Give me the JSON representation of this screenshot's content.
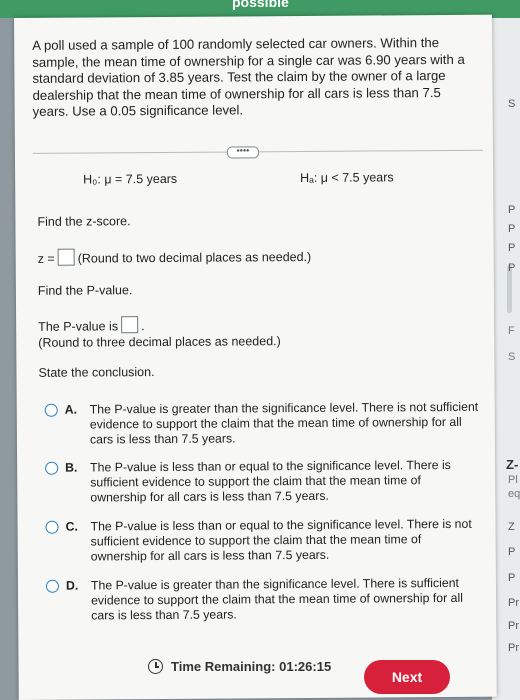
{
  "top_banner": {
    "label": "possible"
  },
  "problem": {
    "text": "A poll used a sample of 100 randomly selected car owners. Within the sample, the mean time of ownership for a single car was 6.90 years with a standard deviation of 3.85 years. Test the claim by the owner of a large dealership that the mean time of ownership for all cars is less than 7.5 years. Use a 0.05 significance level."
  },
  "separator_button": "••••",
  "hypotheses": {
    "h0": "H₀: μ = 7.5 years",
    "ha": "Hₐ: μ < 7.5 years"
  },
  "z_section": {
    "heading": "Find the z-score.",
    "prefix": "z =",
    "instruction": "(Round to two decimal places as needed.)",
    "value": ""
  },
  "p_section": {
    "heading": "Find the P-value.",
    "prefix": "The P-value is",
    "instruction": "(Round to three decimal places as needed.)",
    "value": ""
  },
  "conclusion": {
    "heading": "State the conclusion.",
    "options": [
      {
        "letter": "A.",
        "text": "The P-value is greater than the significance level. There is not sufficient evidence to support the claim that the mean time of ownership for all cars is less than 7.5 years."
      },
      {
        "letter": "B.",
        "text": "The P-value is less than or equal to the significance level. There is sufficient evidence to support the claim that the mean time of ownership for all cars is less than 7.5 years."
      },
      {
        "letter": "C.",
        "text": "The P-value is less than or equal to the significance level. There is not sufficient evidence to support the claim that the mean time of ownership for all cars is less than 7.5 years."
      },
      {
        "letter": "D.",
        "text": "The P-value is greater than the significance level. There is sufficient evidence to support the claim that the mean time of ownership for all cars is less than 7.5 years."
      }
    ]
  },
  "footer": {
    "timer_label": "Time Remaining:",
    "timer_value": "01:26:15",
    "next_label": "Next"
  },
  "sidebar": [
    "S",
    "P",
    "P",
    "P",
    "P",
    "F",
    "S",
    "Z-",
    "Pl",
    "eq",
    "Z",
    "P",
    "P",
    "Pr",
    "Pr",
    "Pr"
  ],
  "colors": {
    "accent_green": "#3f9a63",
    "radio_blue": "#2b7fbf",
    "next_red": "#d7213a"
  }
}
